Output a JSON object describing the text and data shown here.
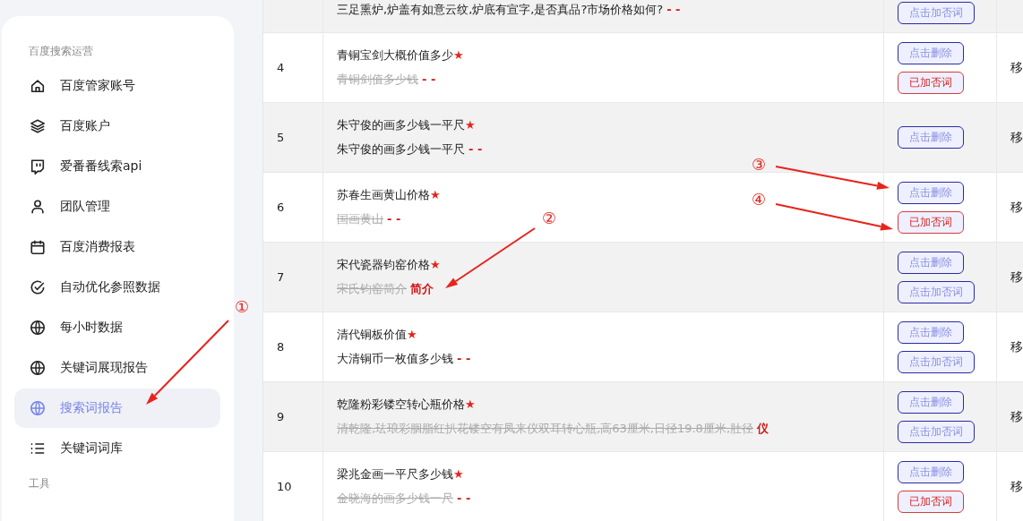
{
  "sidebar": {
    "sections": [
      {
        "title": "百度搜索运营",
        "items": [
          {
            "label": "百度管家账号",
            "kind": "home",
            "selected": false
          },
          {
            "label": "百度账户",
            "kind": "layers",
            "selected": false
          },
          {
            "label": "爱番番线索api",
            "kind": "chat",
            "selected": false
          },
          {
            "label": "团队管理",
            "kind": "user",
            "selected": false
          },
          {
            "label": "百度消费报表",
            "kind": "calendar",
            "selected": false
          },
          {
            "label": "自动优化参照数据",
            "kind": "check",
            "selected": false
          },
          {
            "label": "每小时数据",
            "kind": "globe",
            "selected": false
          },
          {
            "label": "关键词展现报告",
            "kind": "globe",
            "selected": false
          },
          {
            "label": "搜索词报告",
            "kind": "globe",
            "selected": true
          },
          {
            "label": "关键词词库",
            "kind": "list",
            "selected": false
          }
        ]
      },
      {
        "title": "工具"
      }
    ]
  },
  "table": {
    "rows": [
      {
        "term": "三足熏炉,炉盖有如意云纹,炉底有宣字,是否真品?市场价格如何?",
        "struck": false,
        "suffix": "- -",
        "buttons": [
          {
            "label": "点击加否词",
            "kind": "action"
          }
        ]
      },
      {
        "index": "4",
        "keyword": "青铜宝剑大概价值多少",
        "star": "★",
        "term": "青铜剑值多少钱",
        "struck": true,
        "suffix": "- -",
        "buttons": [
          {
            "label": "点击删除",
            "kind": "action"
          },
          {
            "label": "已加否词",
            "kind": "added"
          }
        ],
        "column_4": "移"
      },
      {
        "index": "5",
        "keyword": "朱守俊的画多少钱一平尺",
        "star": "★",
        "term": "朱守俊的画多少钱一平尺",
        "struck": false,
        "suffix": "- -",
        "buttons": [
          {
            "label": "点击删除",
            "kind": "action"
          }
        ],
        "column_4": "移"
      },
      {
        "index": "6",
        "keyword": "苏春生画黄山价格",
        "star": "★",
        "term": "国画黄山",
        "struck": true,
        "suffix": "- -",
        "buttons": [
          {
            "label": "点击删除",
            "kind": "action"
          },
          {
            "label": "已加否词",
            "kind": "added"
          }
        ],
        "column_4": "移"
      },
      {
        "index": "7",
        "keyword": "宋代瓷器钧窑价格",
        "star": "★",
        "term": "宋氏钧窑简介",
        "struck": true,
        "suffix": "简介",
        "buttons": [
          {
            "label": "点击删除",
            "kind": "action"
          },
          {
            "label": "点击加否词",
            "kind": "action"
          }
        ],
        "column_4": "移"
      },
      {
        "index": "8",
        "keyword": "清代铜板价值",
        "star": "★",
        "term": "大清铜币一枚值多少钱",
        "struck": false,
        "suffix": "- -",
        "buttons": [
          {
            "label": "点击删除",
            "kind": "action"
          },
          {
            "label": "点击加否词",
            "kind": "action"
          }
        ],
        "column_4": "移"
      },
      {
        "index": "9",
        "keyword": "乾隆粉彩镂空转心瓶价格",
        "star": "★",
        "term": "清乾隆,珐琅彩胭脂红扒花镂空有凤来仪双耳转心瓶,高63厘米,日径19.8厘米,肚径",
        "struck": true,
        "suffix": "仪",
        "buttons": [
          {
            "label": "点击删除",
            "kind": "action"
          },
          {
            "label": "点击加否词",
            "kind": "action"
          }
        ],
        "column_4": "移"
      },
      {
        "index": "10",
        "keyword": "梁兆金画一平尺多少钱",
        "star": "★",
        "term": "金晓海的画多少钱一尺",
        "struck": true,
        "suffix": "- -",
        "buttons": [
          {
            "label": "点击删除",
            "kind": "action"
          },
          {
            "label": "已加否词",
            "kind": "added"
          }
        ],
        "column_4": "移"
      }
    ]
  },
  "annotations": [
    {
      "label": "①"
    },
    {
      "label": "②"
    },
    {
      "label": "③"
    },
    {
      "label": "④"
    }
  ]
}
